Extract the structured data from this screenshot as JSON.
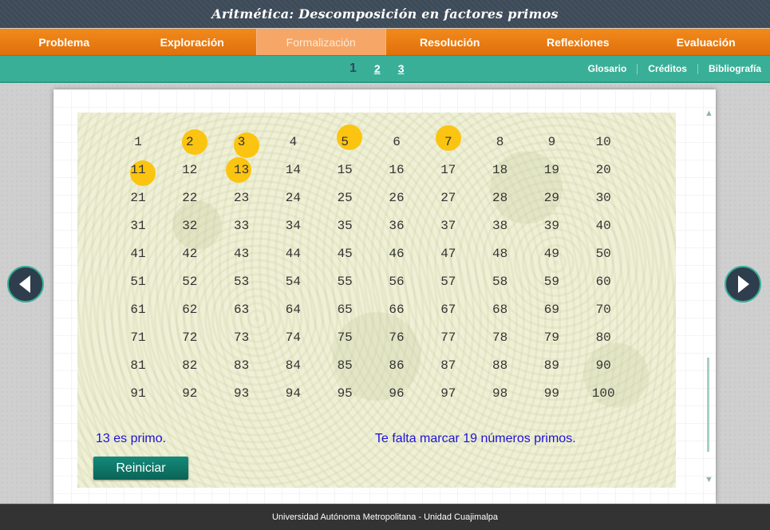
{
  "title": "Aritmética: Descomposición en factores primos",
  "nav": {
    "items": [
      {
        "label": "Problema",
        "active": false
      },
      {
        "label": "Exploración",
        "active": false
      },
      {
        "label": "Formalización",
        "active": true
      },
      {
        "label": "Resolución",
        "active": false
      },
      {
        "label": "Reflexiones",
        "active": false
      },
      {
        "label": "Evaluación",
        "active": false
      }
    ]
  },
  "pages": {
    "items": [
      "1",
      "2",
      "3"
    ],
    "current": "1"
  },
  "links": {
    "glosario": "Glosario",
    "creditos": "Créditos",
    "bibliografia": "Bibliografía"
  },
  "sieve": {
    "start": 1,
    "end": 100,
    "columns": 10,
    "marked": [
      2,
      3,
      5,
      7,
      11,
      13
    ],
    "marker_color": "#fbc410"
  },
  "messages": {
    "status": "13 es primo.",
    "remaining": "Te falta marcar 19 números primos."
  },
  "buttons": {
    "reset": "Reiniciar"
  },
  "footer": "Universidad Autónoma Metropolitana - Unidad Cuajimalpa",
  "colors": {
    "orange": "#f28a1b",
    "teal": "#3aaf97",
    "dark": "#2e3e4c",
    "text_blue": "#1e12d6"
  }
}
